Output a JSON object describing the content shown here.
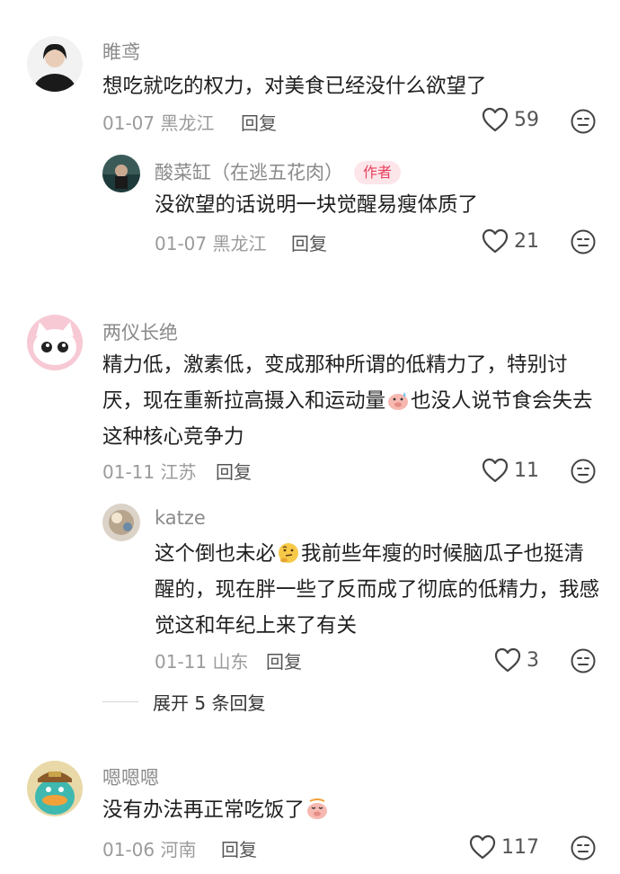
{
  "comments": [
    {
      "username": "睢鸢",
      "text": "想吃就吃的权力，对美食已经没什么欲望了",
      "date": "01-07",
      "location": "黑龙江",
      "reply_label": "回复",
      "likes": "59",
      "replies": [
        {
          "username": "酸菜缸（在逃五花肉）",
          "badge": "作者",
          "text": "没欲望的话说明一块觉醒易瘦体质了",
          "date": "01-07",
          "location": "黑龙江",
          "reply_label": "回复",
          "likes": "21"
        }
      ]
    },
    {
      "username": "两仪长绝",
      "text_before_emoji": "精力低，激素低，变成那种所谓的低精力了，特别讨厌，现在重新拉高摄入和运动量",
      "text_after_emoji": "也没人说节食会失去这种核心竞争力",
      "date": "01-11",
      "location": "江苏",
      "reply_label": "回复",
      "likes": "11",
      "replies": [
        {
          "username": "katze",
          "text_before_emoji": "这个倒也未必",
          "text_after_emoji": "我前些年瘦的时候脑瓜子也挺清醒的，现在胖一些了反而成了彻底的低精力，我感觉这和年纪上来了有关",
          "date": "01-11",
          "location": "山东",
          "reply_label": "回复",
          "likes": "3"
        }
      ],
      "expand_label": "展开 5 条回复"
    },
    {
      "username": "嗯嗯嗯",
      "text_before_emoji": "没有办法再正常吃饭了",
      "date": "01-06",
      "location": "河南",
      "reply_label": "回复",
      "likes": "117"
    }
  ],
  "icons": {
    "like": "heart-outline-icon",
    "dislike": "neutral-face-icon"
  },
  "colors": {
    "author_badge_bg": "#fde6ea",
    "author_badge_text": "#e8425e",
    "meta_gray": "#9b9b9b"
  }
}
